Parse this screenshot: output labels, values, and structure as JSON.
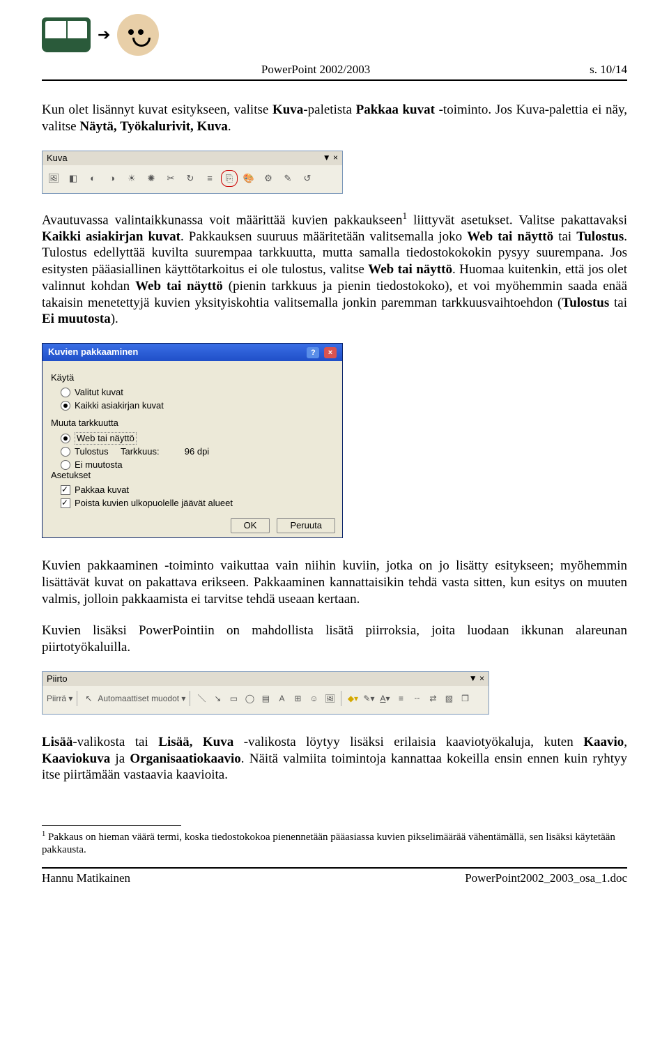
{
  "header": {
    "doc_title": "PowerPoint 2002/2003",
    "page": "s. 10/14"
  },
  "para1_parts": {
    "a": "Kun olet lisännyt kuvat esitykseen, valitse ",
    "b": "Kuva",
    "c": "-paletista ",
    "d": "Pakkaa kuvat",
    "e": " -toiminto. Jos Kuva-palettia ei näy, valitse ",
    "f": "Näytä, Työkalurivit, Kuva",
    "g": "."
  },
  "toolbar_kuva": {
    "title": "Kuva",
    "close": "▼  ×"
  },
  "para2_parts": {
    "a": "Avautuvassa valintaikkunassa voit määrittää kuvien pakkaukseen",
    "sup": "1",
    "b": " liittyvät asetukset. Valitse pakattavaksi ",
    "c": "Kaikki asiakirjan kuvat",
    "d": ". Pakkauksen suuruus määritetään valitsemalla joko ",
    "e": "Web tai näyttö",
    "f": " tai ",
    "g": "Tulostus",
    "h": ". Tulostus edellyttää kuvilta suurempaa tarkkuutta, mutta samalla tiedostokokokin pysyy suurempana. Jos esitysten pääasiallinen käyttötarkoitus ei ole tulostus, valitse ",
    "i": "Web tai näyttö",
    "j": ". Huomaa kuitenkin, että jos olet valinnut kohdan ",
    "k": "Web tai näyttö",
    "l": " (pienin tarkkuus ja pienin tiedostokoko), et voi myöhemmin saada enää takaisin menetettyjä kuvien yksityiskohtia valitsemalla jonkin paremman tarkkuusvaihtoehdon (",
    "m": "Tulostus",
    "n": " tai ",
    "o": "Ei muutosta",
    "p": ")."
  },
  "dialog": {
    "title": "Kuvien pakkaaminen",
    "group1": "Käytä",
    "r1": "Valitut kuvat",
    "r2": "Kaikki asiakirjan kuvat",
    "group2": "Muuta tarkkuutta",
    "r3": "Web tai näyttö",
    "r4": "Tulostus",
    "r5": "Ei muutosta",
    "tarkkuus_label": "Tarkkuus:",
    "tarkkuus_value": "96 dpi",
    "group3": "Asetukset",
    "c1": "Pakkaa kuvat",
    "c2": "Poista kuvien ulkopuolelle jäävät alueet",
    "ok": "OK",
    "cancel": "Peruuta"
  },
  "para3": "Kuvien pakkaaminen -toiminto vaikuttaa vain niihin kuviin, jotka on jo lisätty esitykseen; myöhemmin lisättävät kuvat on pakattava erikseen. Pakkaaminen kannattaisikin tehdä vasta sitten, kun esitys on muuten valmis, jolloin pakkaamista ei tarvitse tehdä useaan kertaan.",
  "para4": "Kuvien lisäksi PowerPointiin on mahdollista lisätä piirroksia, joita luodaan ikkunan alareunan piirtotyökaluilla.",
  "toolbar_piirto": {
    "title": "Piirto",
    "close": "▼  ×",
    "piirra": "Piirrä ▾",
    "auto": "Automaattiset muodot ▾"
  },
  "para5_parts": {
    "a": "Lisää",
    "b": "-valikosta tai ",
    "c": "Lisää, Kuva",
    "d": " -valikosta löytyy lisäksi erilaisia kaaviotyökaluja, kuten ",
    "e": "Kaavio",
    "f": ", ",
    "g": "Kaaviokuva",
    "h": " ja ",
    "i": "Organisaatiokaavio",
    "j": ". Näitä valmiita toimintoja kannattaa kokeilla ensin ennen kuin ryhtyy itse piirtämään vastaavia kaavioita."
  },
  "footnote": {
    "num": "1",
    "text": " Pakkaus on hieman väärä termi, koska tiedostokokoa pienennetään pääasiassa kuvien pikselimäärää vähentämällä, sen lisäksi käytetään pakkausta."
  },
  "footer": {
    "author": "Hannu Matikainen",
    "file": "PowerPoint2002_2003_osa_1.doc"
  }
}
